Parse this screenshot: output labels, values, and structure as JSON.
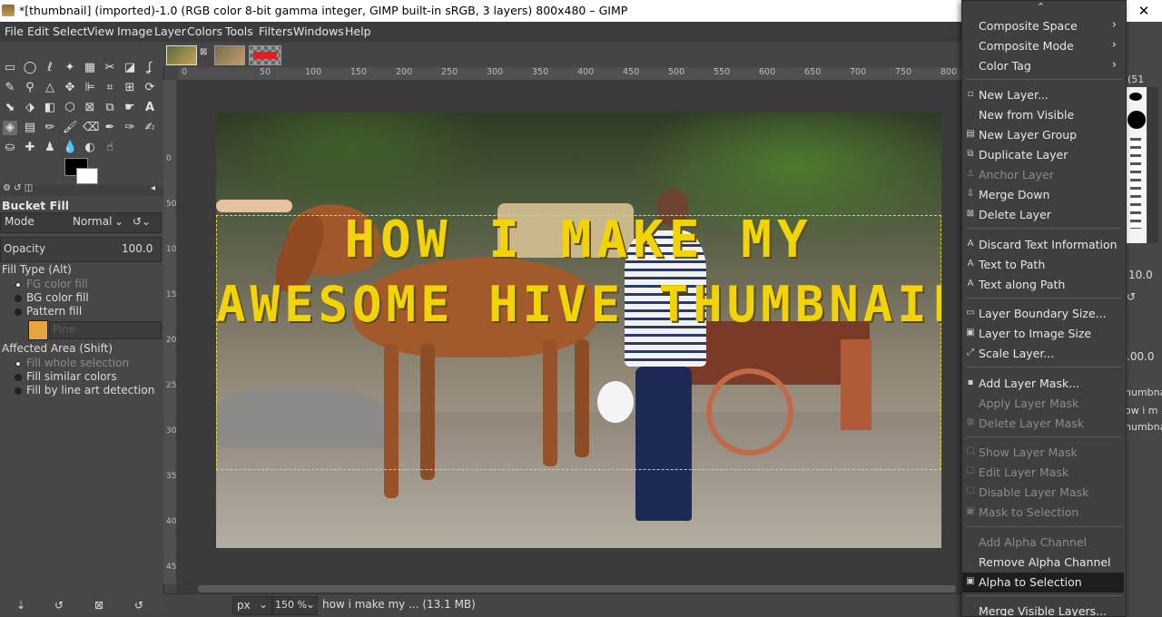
{
  "window": {
    "title": "*[thumbnail] (imported)-1.0 (RGB color 8-bit gamma integer, GIMP built-in sRGB, 3 layers) 800x480 – GIMP",
    "close_label": "✕"
  },
  "menubar": [
    "File",
    "Edit",
    "Select",
    "View",
    "Image",
    "Layer",
    "Colors",
    "Tools",
    "Filters",
    "Windows",
    "Help"
  ],
  "tool_options": {
    "title": "Bucket Fill",
    "mode_label": "Mode",
    "mode_value": "Normal",
    "opacity_label": "Opacity",
    "opacity_value": "100.0",
    "fill_type_label": "Fill Type  (Alt)",
    "fill_types": [
      "FG color fill",
      "BG color fill",
      "Pattern fill"
    ],
    "pattern_name": "Pine",
    "affected_area_label": "Affected Area  (Shift)",
    "affected_areas": [
      "Fill whole selection",
      "Fill similar colors",
      "Fill by line art detection"
    ]
  },
  "canvas": {
    "thumbnail_line1": "HOW I MAKE MY",
    "thumbnail_line2": "AWESOME HIVE THUMBNAILS"
  },
  "rulers": {
    "horizontal": [
      "0",
      "50",
      "100",
      "150",
      "200",
      "250",
      "300",
      "350",
      "400",
      "450",
      "500",
      "550",
      "600",
      "650",
      "700",
      "750",
      "800"
    ],
    "vertical": [
      "0",
      "50",
      "100",
      "150",
      "200",
      "250",
      "300",
      "350",
      "400",
      "450"
    ]
  },
  "statusbar": {
    "unit": "px",
    "zoom": "150 %",
    "info": "how  i  make  my ... (13.1 MB)"
  },
  "dock": {
    "brush_size": "(51",
    "value1": "10.0",
    "value2": ".00.0",
    "layer_texts": [
      "humbnail",
      "ow  i  m",
      "humbnai"
    ]
  },
  "context_menu": {
    "top_arrow": "⌃",
    "items": [
      {
        "label": "Composite Space",
        "submenu": true
      },
      {
        "label": "Composite Mode",
        "submenu": true
      },
      {
        "label": "Color Tag",
        "submenu": true
      },
      {
        "label": "New Layer...",
        "icon": "new-layer-icon"
      },
      {
        "label": "New from Visible"
      },
      {
        "label": "New Layer Group",
        "icon": "layer-group-icon"
      },
      {
        "label": "Duplicate Layer",
        "icon": "duplicate-icon"
      },
      {
        "label": "Anchor Layer",
        "icon": "anchor-icon",
        "disabled": true
      },
      {
        "label": "Merge Down",
        "icon": "merge-icon"
      },
      {
        "label": "Delete Layer",
        "icon": "delete-icon"
      },
      {
        "label": "Discard Text Information",
        "icon": "text-icon"
      },
      {
        "label": "Text to Path",
        "icon": "text-icon"
      },
      {
        "label": "Text along Path",
        "icon": "text-icon"
      },
      {
        "label": "Layer Boundary Size...",
        "icon": "boundary-icon"
      },
      {
        "label": "Layer to Image Size",
        "icon": "resize-icon"
      },
      {
        "label": "Scale Layer...",
        "icon": "scale-icon"
      },
      {
        "label": "Add Layer Mask...",
        "icon": "mask-icon"
      },
      {
        "label": "Apply Layer Mask",
        "disabled": true
      },
      {
        "label": "Delete Layer Mask",
        "icon": "delete-icon",
        "disabled": true
      },
      {
        "label": "Show Layer Mask",
        "icon": "checkbox-icon",
        "disabled": true
      },
      {
        "label": "Edit Layer Mask",
        "icon": "checkbox-icon",
        "disabled": true
      },
      {
        "label": "Disable Layer Mask",
        "icon": "checkbox-icon",
        "disabled": true
      },
      {
        "label": "Mask to Selection",
        "icon": "selection-icon",
        "disabled": true
      },
      {
        "label": "Add Alpha Channel",
        "disabled": true
      },
      {
        "label": "Remove Alpha Channel"
      },
      {
        "label": "Alpha to Selection",
        "icon": "selection-icon",
        "highlighted": true
      },
      {
        "label": "Merge Visible Layers..."
      }
    ]
  }
}
